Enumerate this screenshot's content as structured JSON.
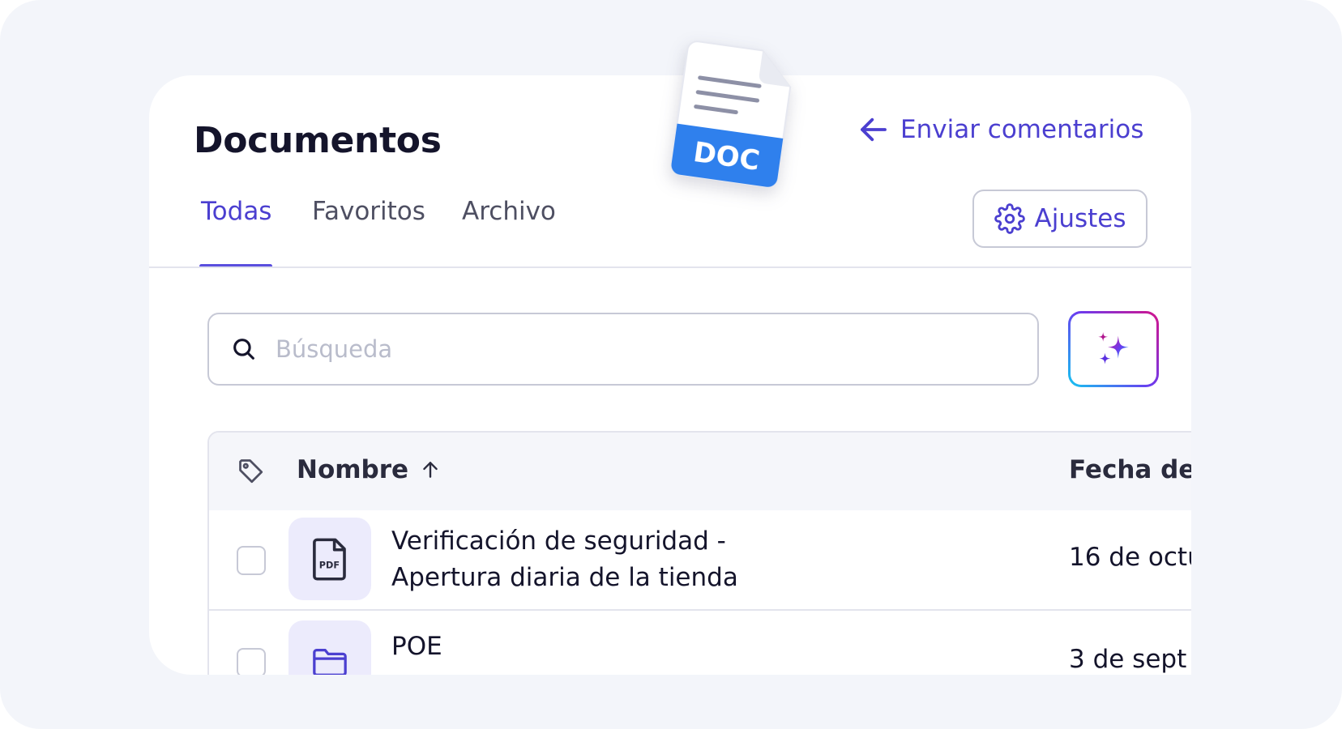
{
  "header": {
    "title": "Documentos",
    "feedback_label": "Enviar comentarios"
  },
  "tabs": [
    {
      "label": "Todas",
      "active": true
    },
    {
      "label": "Favoritos",
      "active": false
    },
    {
      "label": "Archivo",
      "active": false
    }
  ],
  "settings": {
    "label": "Ajustes"
  },
  "search": {
    "placeholder": "Búsqueda",
    "value": ""
  },
  "table": {
    "columns": {
      "name": "Nombre",
      "date": "Fecha de r"
    },
    "sort": "ascending",
    "rows": [
      {
        "icon": "pdf-file-icon",
        "icon_label": "PDF",
        "name_line1": "Verificación de seguridad -",
        "name_line2": "Apertura diaria de la tienda",
        "date": "16 de octu"
      },
      {
        "icon": "folder-icon",
        "name_line1": "POE",
        "date": "3 de sept"
      }
    ]
  },
  "sticker": {
    "label": "DOC",
    "icon": "doc-file-icon"
  },
  "colors": {
    "accent": "#4b3fd0",
    "sticker_blue": "#2f80ed",
    "background": "#f3f5fa"
  }
}
